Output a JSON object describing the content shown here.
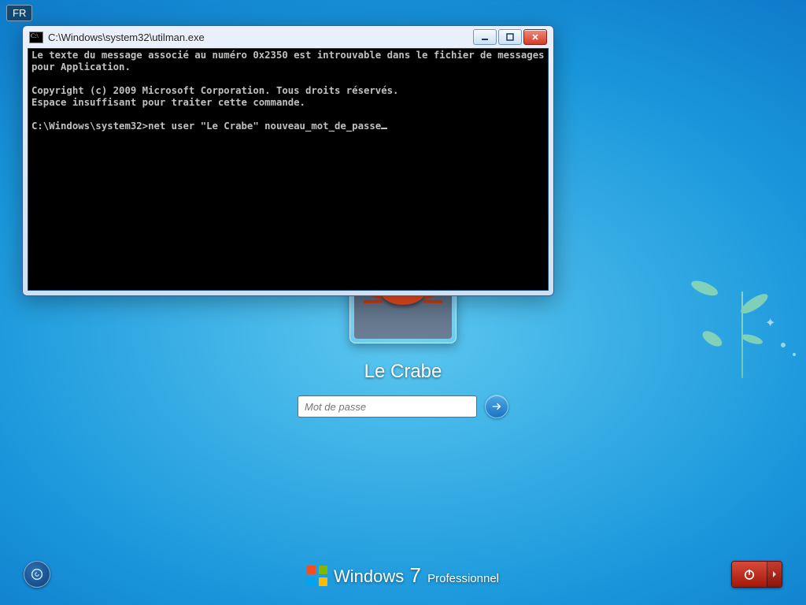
{
  "lang_badge": "FR",
  "login": {
    "username": "Le Crabe",
    "password_placeholder": "Mot de passe"
  },
  "branding": {
    "product": "Windows",
    "version": "7",
    "edition": "Professionnel"
  },
  "console": {
    "title": "C:\\Windows\\system32\\utilman.exe",
    "lines": [
      "Le texte du message associé au numéro 0x2350 est introuvable dans le fichier de messages pour Application.",
      "",
      "Copyright (c) 2009 Microsoft Corporation. Tous droits réservés.",
      "Espace insuffisant pour traiter cette commande.",
      ""
    ],
    "prompt": "C:\\Windows\\system32>",
    "command": "net user \"Le Crabe\" nouveau_mot_de_passe"
  }
}
